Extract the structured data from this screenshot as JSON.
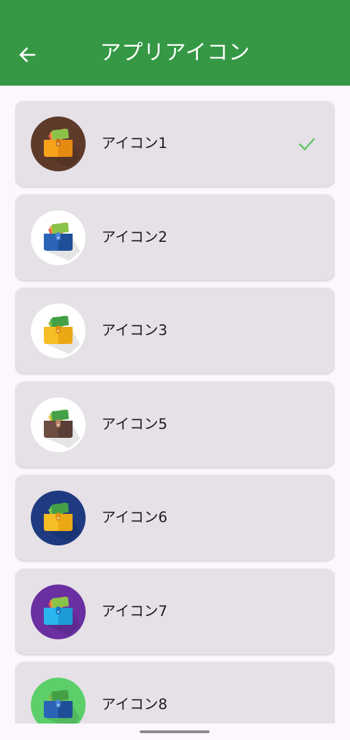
{
  "app_bar": {
    "title": "アプリアイコン",
    "back_icon": "arrow-back-icon",
    "background_color": "#359844"
  },
  "icons": [
    {
      "label": "アイコン1",
      "selected": true,
      "bg_color": "#5d3a2a",
      "wallet_color": "#f7a21b",
      "wallet_shade": "#e38a10",
      "clasp_color": "#c8731a",
      "bill_colors": [
        "#e35d4f",
        "#f59e3d",
        "#8bc34a"
      ]
    },
    {
      "label": "アイコン2",
      "selected": false,
      "bg_color": "#ffffff",
      "wallet_color": "#2b64b6",
      "wallet_shade": "#1f4f97",
      "clasp_color": "#4a87d6",
      "bill_colors": [
        "#e35d4f",
        "#f59e3d",
        "#8bc34a"
      ]
    },
    {
      "label": "アイコン3",
      "selected": false,
      "bg_color": "#ffffff",
      "wallet_color": "#f7bd24",
      "wallet_shade": "#eaa814",
      "clasp_color": "#e08f12",
      "bill_colors": [
        "#8bc34a",
        "#5fb54e",
        "#43a047"
      ]
    },
    {
      "label": "アイコン5",
      "selected": false,
      "bg_color": "#ffffff",
      "wallet_color": "#6d4c41",
      "wallet_shade": "#5a3d34",
      "clasp_color": "#b9876b",
      "bill_colors": [
        "#f5c542",
        "#8bc34a",
        "#43a047"
      ]
    },
    {
      "label": "アイコン6",
      "selected": false,
      "bg_color": "#1e3a80",
      "wallet_color": "#f7bd24",
      "wallet_shade": "#eaa814",
      "clasp_color": "#e08f12",
      "bill_colors": [
        "#8bc34a",
        "#5fb54e",
        "#43a047"
      ]
    },
    {
      "label": "アイコン7",
      "selected": false,
      "bg_color": "#6a2fa0",
      "wallet_color": "#2bb5ef",
      "wallet_shade": "#1e9bd6",
      "clasp_color": "#1478c0",
      "bill_colors": [
        "#e35d4f",
        "#f59e3d",
        "#8bc34a"
      ]
    },
    {
      "label": "アイコン8",
      "selected": false,
      "bg_color": "#5ccf6a",
      "wallet_color": "#2b64b6",
      "wallet_shade": "#1f4f97",
      "clasp_color": "#4a87d6",
      "bill_colors": [
        "#8bc34a",
        "#5fb54e",
        "#43a047"
      ]
    }
  ],
  "check_icon": "checkmark-icon",
  "check_color": "#5cc466"
}
